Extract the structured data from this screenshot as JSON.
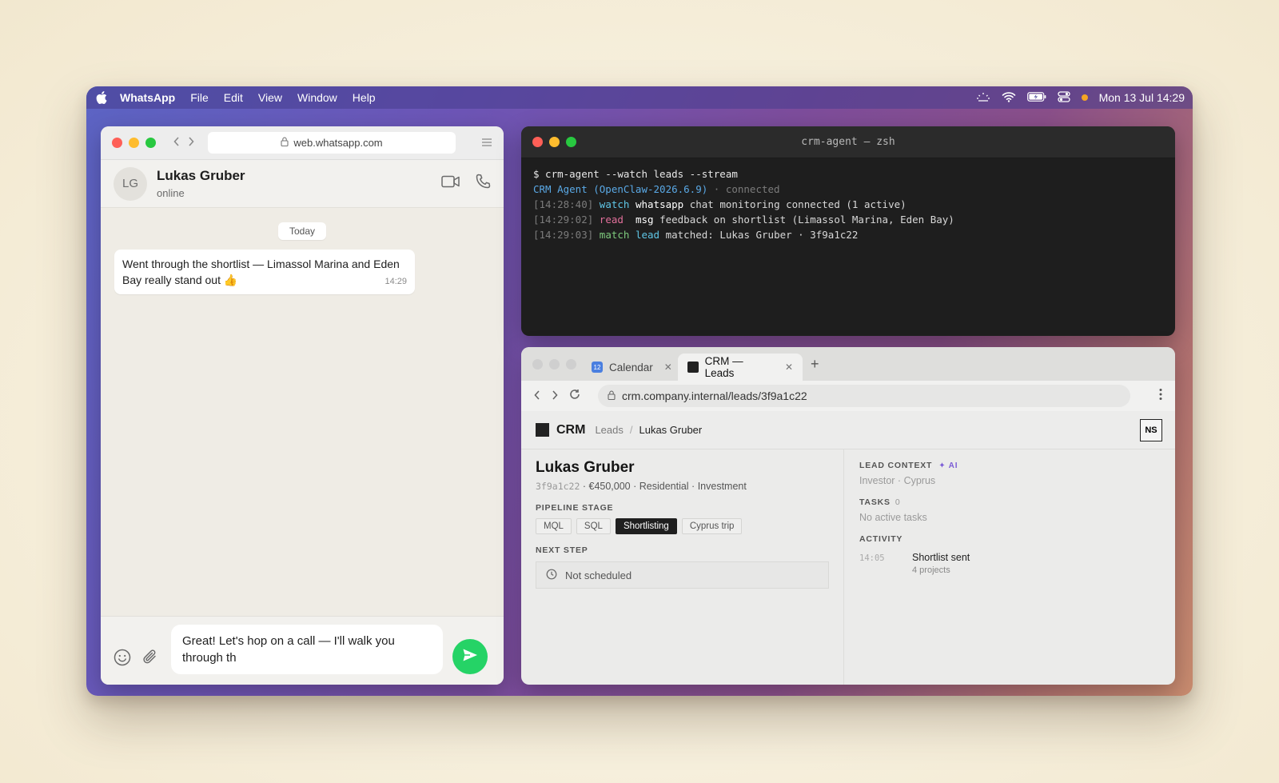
{
  "menubar": {
    "app": "WhatsApp",
    "menus": [
      "File",
      "Edit",
      "View",
      "Window",
      "Help"
    ],
    "clock": "Mon 13 Jul 14:29"
  },
  "whatsapp": {
    "url": "web.whatsapp.com",
    "contact": {
      "initials": "LG",
      "name": "Lukas Gruber",
      "status": "online"
    },
    "day_chip": "Today",
    "message": {
      "text": "Went through the shortlist — Limassol Marina and Eden Bay really stand out 👍",
      "time": "14:29"
    },
    "draft": "Great! Let's hop on a call — I'll walk you through th"
  },
  "terminal": {
    "title": "crm-agent — zsh",
    "command": "$ crm-agent --watch leads --stream",
    "agent": "CRM Agent (OpenClaw-2026.6.9)",
    "agent_status": " · connected",
    "lines": [
      {
        "ts": "[14:28:40]",
        "verb": "watch",
        "obj": "whatsapp",
        "msg": "chat monitoring connected (1 active)"
      },
      {
        "ts": "[14:29:02]",
        "verb": "read ",
        "obj": "msg",
        "msg": "feedback on shortlist (Limassol Marina, Eden Bay)"
      },
      {
        "ts": "[14:29:03]",
        "verb": "match",
        "obj": "lead",
        "msg": "matched: Lukas Gruber · 3f9a1c22"
      }
    ]
  },
  "browser": {
    "tabs": [
      {
        "label": "Calendar",
        "icon_text": "12"
      },
      {
        "label": "CRM — Leads"
      }
    ],
    "url": "crm.company.internal/leads/3f9a1c22"
  },
  "crm": {
    "brand": "CRM",
    "breadcrumb": {
      "section": "Leads",
      "sep": "/",
      "current": "Lukas Gruber"
    },
    "user_initials": "NS",
    "lead": {
      "name": "Lukas Gruber",
      "id": "3f9a1c22",
      "meta": " · €450,000 · Residential · Investment"
    },
    "pipeline_label": "PIPELINE STAGE",
    "stages": [
      "MQL",
      "SQL",
      "Shortlisting",
      "Cyprus trip"
    ],
    "active_stage": "Shortlisting",
    "next_step_label": "NEXT STEP",
    "next_step_value": "Not scheduled",
    "context_label": "LEAD CONTEXT",
    "ai_label": "✦ AI",
    "context_value": "Investor · Cyprus",
    "tasks_label": "TASKS",
    "tasks_count": "0",
    "tasks_value": "No active tasks",
    "activity_label": "ACTIVITY",
    "activity": [
      {
        "time": "14:05",
        "title": "Shortlist sent",
        "sub": "4 projects"
      }
    ]
  },
  "colors": {
    "send_button": "#25d366",
    "active_stage_bg": "#1f1f1f",
    "ai_accent": "#7b5cd6"
  }
}
